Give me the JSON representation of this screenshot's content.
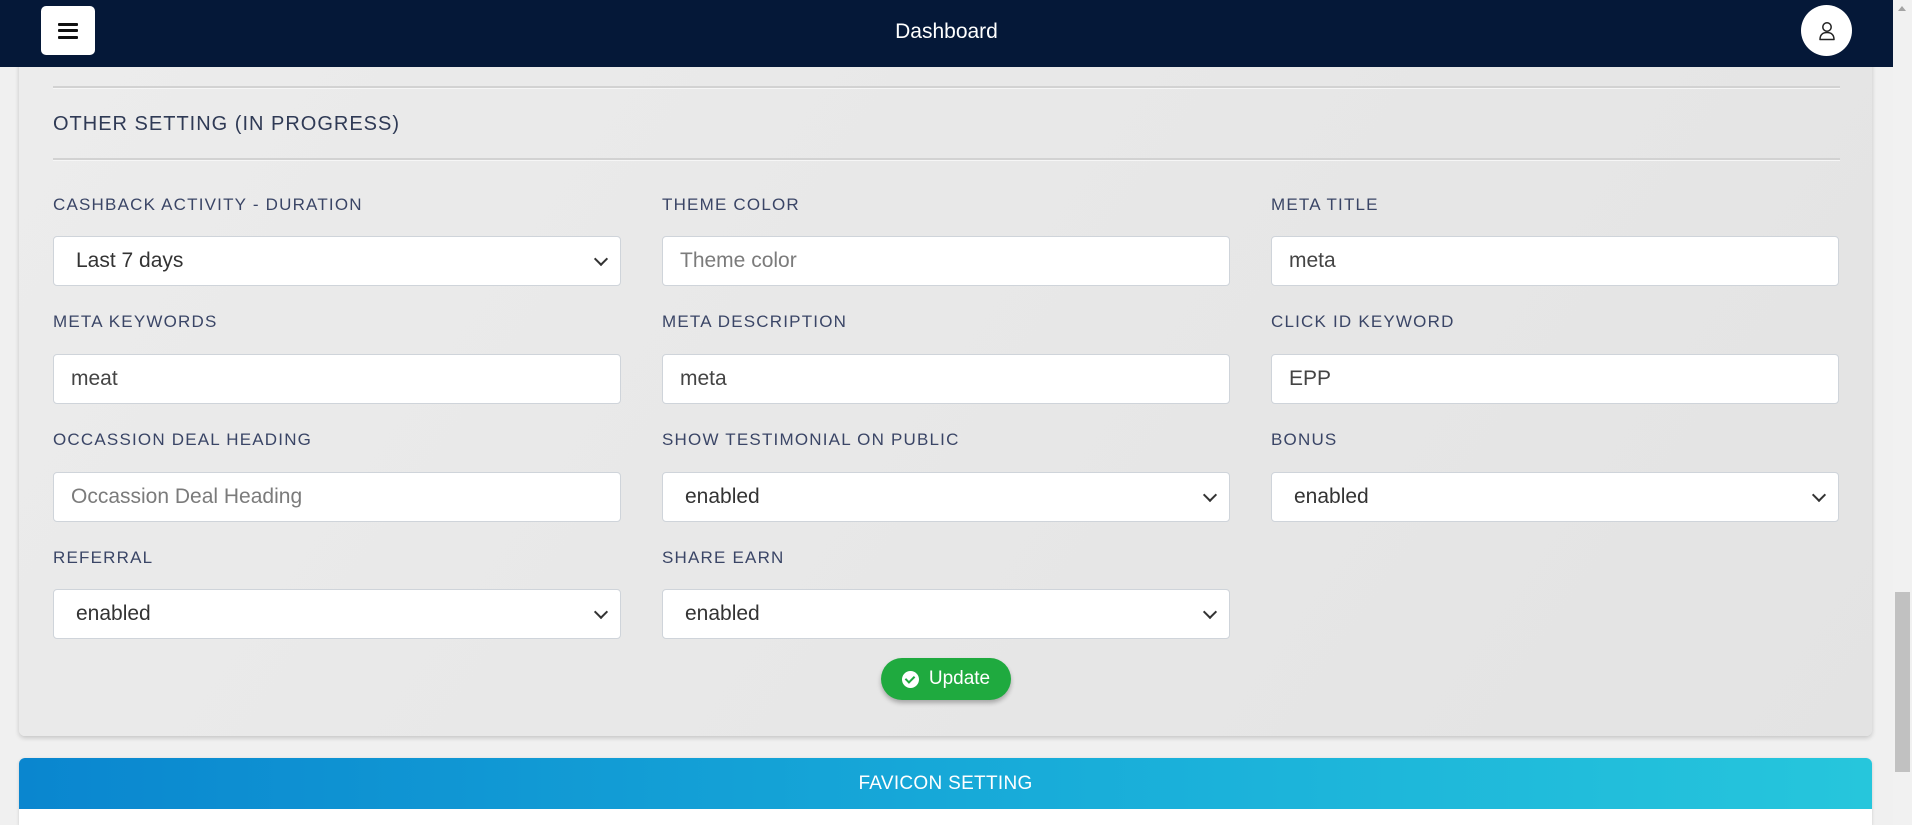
{
  "topbar": {
    "title": "Dashboard",
    "menu_icon": "hamburger-icon",
    "user_icon": "user-icon"
  },
  "section": {
    "title": "OTHER SETTING (IN PROGRESS)"
  },
  "fields": {
    "cashback_duration": {
      "label": "CASHBACK ACTIVITY - DURATION",
      "value": "Last 7 days"
    },
    "theme_color": {
      "label": "THEME COLOR",
      "value": "",
      "placeholder": "Theme color"
    },
    "meta_title": {
      "label": "META TITLE",
      "value": "meta",
      "placeholder": ""
    },
    "meta_keywords": {
      "label": "META KEYWORDS",
      "value": "meat",
      "placeholder": ""
    },
    "meta_description": {
      "label": "META DESCRIPTION",
      "value": "meta",
      "placeholder": ""
    },
    "click_id_keyword": {
      "label": "CLICK ID KEYWORD",
      "value": "EPP",
      "placeholder": ""
    },
    "occassion_deal_heading": {
      "label": "OCCASSION DEAL HEADING",
      "value": "",
      "placeholder": "Occassion Deal Heading"
    },
    "show_testimonial": {
      "label": "SHOW TESTIMONIAL ON PUBLIC",
      "value": "enabled"
    },
    "bonus": {
      "label": "BONUS",
      "value": "enabled"
    },
    "referral": {
      "label": "REFERRAL",
      "value": "enabled"
    },
    "share_earn": {
      "label": "SHARE EARN",
      "value": "enabled"
    }
  },
  "actions": {
    "update_label": "Update",
    "update_icon": "check-circle-icon"
  },
  "favicon_section": {
    "title": "FAVICON SETTING"
  },
  "colors": {
    "navbar": "#051838",
    "update_button": "#1faa3f",
    "favicon_header_start": "#0a86cf",
    "favicon_header_end": "#26c6dc"
  }
}
